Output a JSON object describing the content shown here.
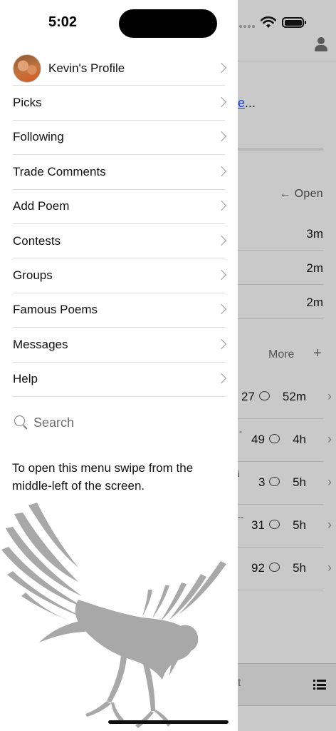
{
  "status": {
    "time": "5:02"
  },
  "drawer": {
    "profile_label": "Kevin's Profile",
    "items": [
      {
        "label": "Picks"
      },
      {
        "label": "Following"
      },
      {
        "label": "Trade Comments"
      },
      {
        "label": "Add Poem"
      },
      {
        "label": "Contests"
      },
      {
        "label": "Groups"
      },
      {
        "label": "Famous Poems"
      },
      {
        "label": "Messages"
      },
      {
        "label": "Help"
      }
    ],
    "search_label": "Search",
    "hint": "To open this menu swipe from the middle-left of the screen."
  },
  "background": {
    "link_fragment": "e",
    "link_ellipsis": "...",
    "open_label": "← Open",
    "times": [
      "3m",
      "2m",
      "2m"
    ],
    "more_label": "More",
    "plus_label": "+",
    "poems": [
      {
        "fragment": "",
        "comments": "27",
        "age": "52m"
      },
      {
        "fragment": "-",
        "comments": "49",
        "age": "4h"
      },
      {
        "fragment": "i",
        "comments": "3",
        "age": "5h"
      },
      {
        "fragment": "--",
        "comments": "31",
        "age": "5h"
      },
      {
        "fragment": "",
        "comments": "92",
        "age": "5h"
      }
    ],
    "tab_fragment": "t"
  }
}
